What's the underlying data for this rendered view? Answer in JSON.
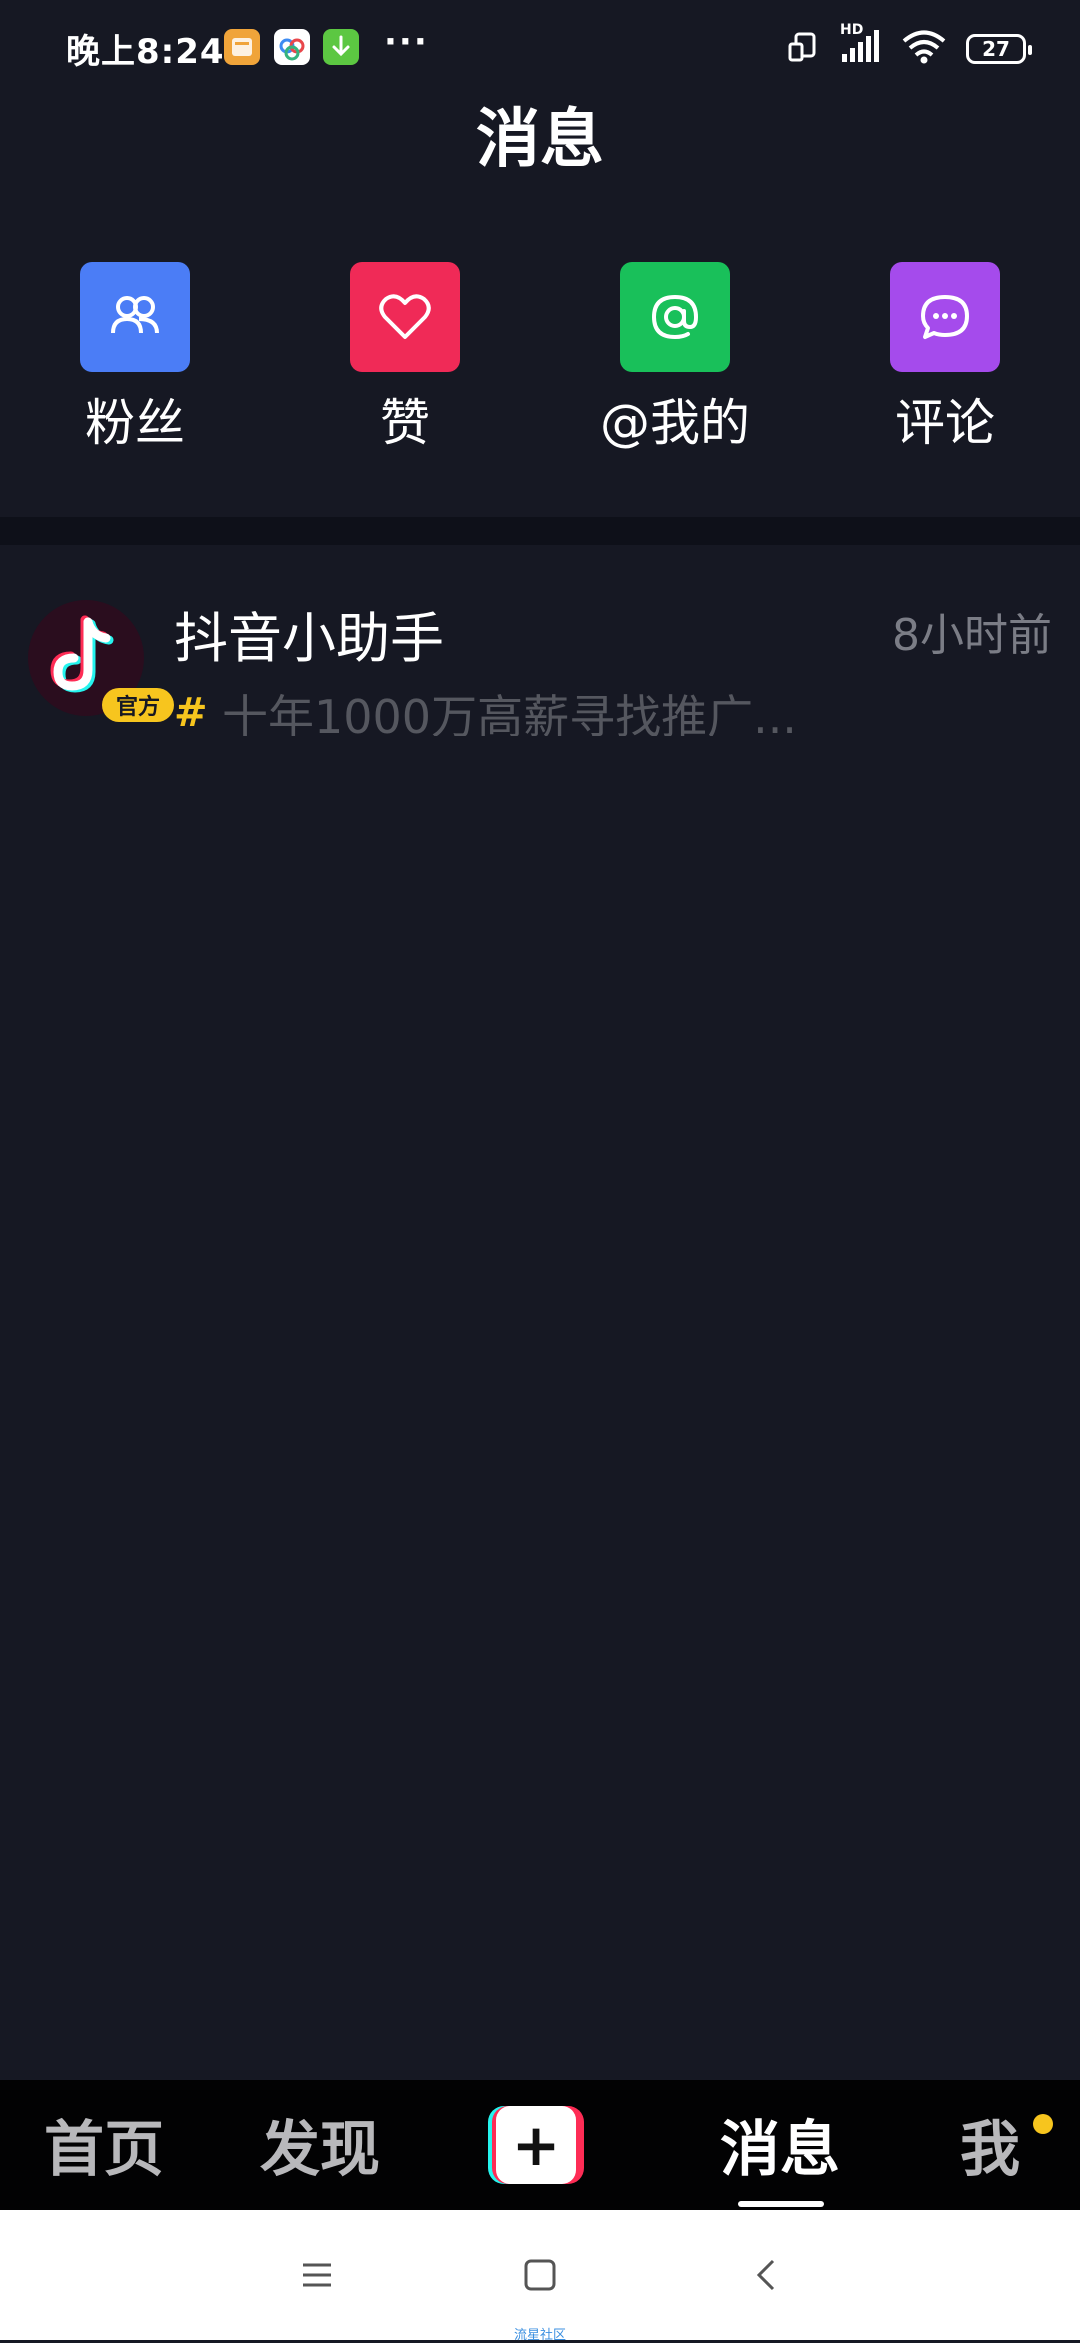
{
  "status_bar": {
    "time": "晚上8:24",
    "more": "···",
    "battery": "27",
    "signal_label": "HD"
  },
  "page_title": "消息",
  "shortcuts": [
    {
      "label": "粉丝",
      "icon": "fans-icon",
      "color": "#4b7df6"
    },
    {
      "label": "赞",
      "icon": "heart-icon",
      "color": "#f02a57"
    },
    {
      "label": "@我的",
      "icon": "at-icon",
      "color": "#19c05a"
    },
    {
      "label": "评论",
      "icon": "comment-icon",
      "color": "#a54bec"
    }
  ],
  "messages": [
    {
      "name": "抖音小助手",
      "time": "8小时前",
      "badge": "官方",
      "hash": "#",
      "preview": "十年1000万高薪寻找推广..."
    }
  ],
  "tabs": [
    {
      "label": "首页",
      "active": false
    },
    {
      "label": "发现",
      "active": false
    },
    {
      "label": "+",
      "active": false
    },
    {
      "label": "消息",
      "active": true
    },
    {
      "label": "我",
      "active": false
    }
  ],
  "watermark": "流星社区",
  "colors": {
    "background": "#161823",
    "accent_yellow": "#f7c51e",
    "tiktok_cyan": "#25f4ee",
    "tiktok_red": "#fe2c55"
  }
}
